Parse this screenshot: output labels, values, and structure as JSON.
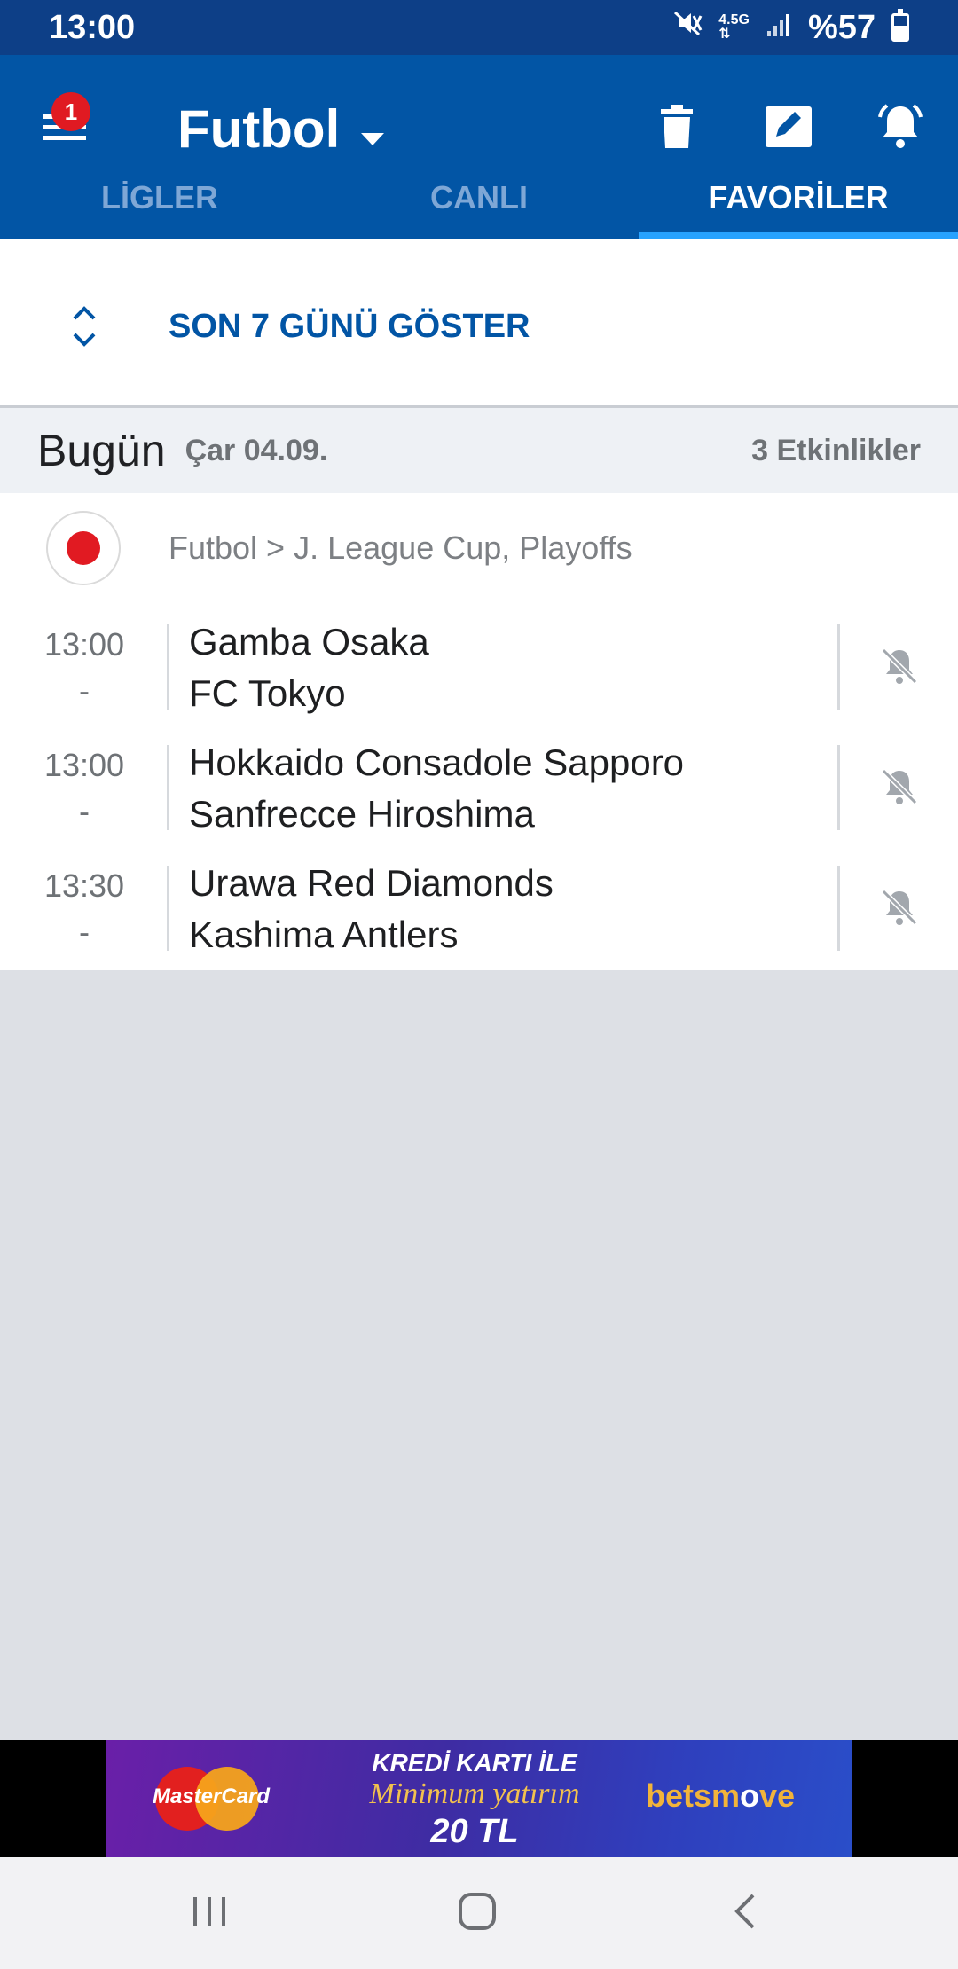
{
  "status_bar": {
    "time": "13:00",
    "network": "4.5G",
    "battery": "%57",
    "battery_level": 0.57,
    "icons": [
      "mute-vibrate-icon",
      "network-4.5g-icon",
      "signal-icon",
      "battery-icon"
    ]
  },
  "toolbar": {
    "notification_count": "1",
    "sport": "Futbol",
    "icons": [
      "menu-icon",
      "dropdown-caret-icon",
      "trash-icon",
      "edit-icon",
      "bell-icon"
    ]
  },
  "tabs": [
    {
      "label": "LİGLER",
      "active": false
    },
    {
      "label": "CANLI",
      "active": false
    },
    {
      "label": "FAVORİLER",
      "active": true
    }
  ],
  "show_days": {
    "label": "SON 7 GÜNÜ GÖSTER"
  },
  "date_header": {
    "day": "Bugün",
    "date": "Çar 04.09.",
    "events": "3 Etkinlikler"
  },
  "league": {
    "label": "Futbol > J. League Cup, Playoffs",
    "flag": "japan-flag-icon"
  },
  "matches": [
    {
      "time": "13:00",
      "score": "-",
      "home": "Gamba Osaka",
      "away": "FC Tokyo"
    },
    {
      "time": "13:00",
      "score": "-",
      "home": "Hokkaido Consadole Sapporo",
      "away": "Sanfrecce Hiroshima"
    },
    {
      "time": "13:30",
      "score": "-",
      "home": "Urawa Red Diamonds",
      "away": "Kashima Antlers"
    }
  ],
  "ad": {
    "card_brand": "MasterCard",
    "line1": "KREDİ KARTI İLE",
    "line2": "Minimum yatırım",
    "line3": "20 TL",
    "brand_a": "betsm",
    "brand_b": "o",
    "brand_c": "ve"
  },
  "nav_bar": {
    "icons": [
      "recent-apps-icon",
      "home-icon",
      "back-icon"
    ]
  },
  "colors": {
    "primary": "#0255a5",
    "status_bar": "#0d3f87",
    "tab_indicator": "#27a2ff",
    "badge": "#e01a22",
    "background": "#dde0e5"
  }
}
